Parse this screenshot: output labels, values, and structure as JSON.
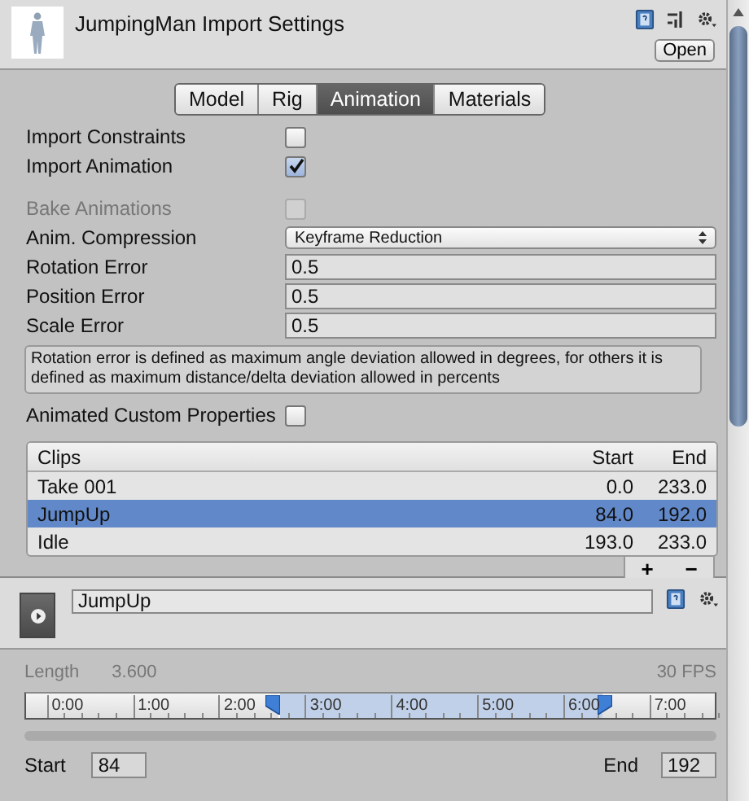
{
  "header": {
    "title": "JumpingMan Import Settings",
    "open_button": "Open"
  },
  "tabs": [
    {
      "label": "Model",
      "selected": false
    },
    {
      "label": "Rig",
      "selected": false
    },
    {
      "label": "Animation",
      "selected": true
    },
    {
      "label": "Materials",
      "selected": false
    }
  ],
  "settings": [
    {
      "kind": "checkbox",
      "label": "Import Constraints",
      "checked": false,
      "disabled": false
    },
    {
      "kind": "checkbox",
      "label": "Import Animation",
      "checked": true,
      "disabled": false
    },
    {
      "kind": "gap"
    },
    {
      "kind": "checkbox",
      "label": "Bake Animations",
      "checked": false,
      "disabled": true
    },
    {
      "kind": "dropdown",
      "label": "Anim. Compression",
      "value": "Keyframe Reduction"
    },
    {
      "kind": "field",
      "label": "Rotation Error",
      "value": "0.5"
    },
    {
      "kind": "field",
      "label": "Position Error",
      "value": "0.5"
    },
    {
      "kind": "field",
      "label": "Scale Error",
      "value": "0.5"
    },
    {
      "kind": "help",
      "text": "Rotation error is defined as maximum angle deviation allowed in degrees, for others it is defined as maximum distance/delta deviation allowed in percents"
    },
    {
      "kind": "checkbox",
      "label": "Animated Custom Properties",
      "checked": false,
      "disabled": false
    }
  ],
  "clips": {
    "columns": [
      "Clips",
      "Start",
      "End"
    ],
    "rows": [
      {
        "name": "Take 001",
        "start": "0.0",
        "end": "233.0",
        "selected": false
      },
      {
        "name": "JumpUp",
        "start": "84.0",
        "end": "192.0",
        "selected": true
      },
      {
        "name": "Idle",
        "start": "193.0",
        "end": "233.0",
        "selected": false
      }
    ],
    "add": "+",
    "remove": "−"
  },
  "clip": {
    "name": "JumpUp",
    "length_label": "Length",
    "length": "3.600",
    "fps": "30 FPS",
    "ticks": [
      "0:00",
      "1:00",
      "2:00",
      "3:00",
      "4:00",
      "5:00",
      "6:00",
      "7:00"
    ],
    "handles": [
      {
        "level": 0.367
      },
      {
        "level": 0.835
      }
    ],
    "start_label": "Start",
    "start": "84",
    "end_label": "End",
    "end": "192"
  }
}
